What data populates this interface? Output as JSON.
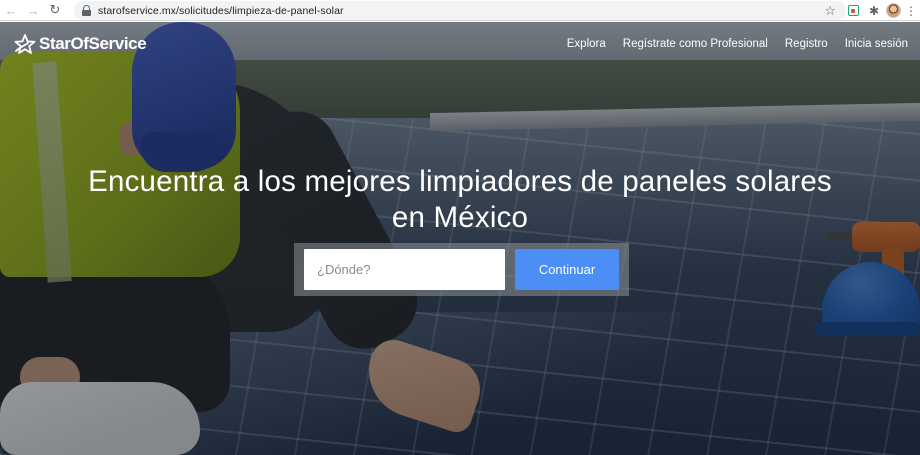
{
  "browser": {
    "url": "starofservice.mx/solicitudes/limpieza-de-panel-solar",
    "icons": {
      "back": "arrow-left-icon",
      "forward": "arrow-right-icon",
      "reload": "reload-icon",
      "lock": "lock-icon",
      "bookmark": "star-icon",
      "extension_1": "grammarly-icon",
      "extensions": "puzzle-icon",
      "profile": "avatar-icon",
      "menu": "kebab-menu-icon"
    }
  },
  "site": {
    "logo_text": "StarOfService",
    "nav": [
      "Explora",
      "Regístrate como Profesional",
      "Registro",
      "Inicia sesión"
    ]
  },
  "hero": {
    "headline_line1": "Encuentra a los mejores limpiadores de paneles solares",
    "headline_line2": "en México",
    "search_placeholder": "¿Dónde?",
    "search_value": "",
    "continue_label": "Continuar",
    "colors": {
      "button": "#4b8ef6",
      "text": "#ffffff"
    }
  }
}
